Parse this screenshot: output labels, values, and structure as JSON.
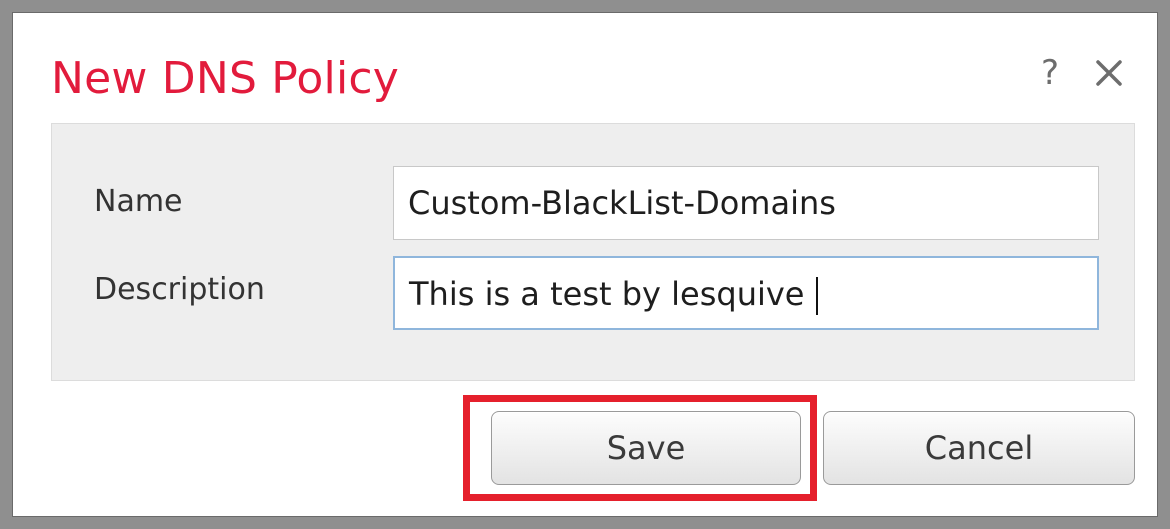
{
  "dialog": {
    "title": "New DNS Policy",
    "help_glyph": "?",
    "icons": [
      "help-icon",
      "close-icon"
    ]
  },
  "form": {
    "name_label": "Name",
    "name_value": "Custom-BlackList-Domains",
    "description_label": "Description",
    "description_value": "This is a test by lesquive"
  },
  "buttons": {
    "save_label": "Save",
    "cancel_label": "Cancel"
  },
  "colors": {
    "title": "#e21b3c",
    "highlight": "#e5202c",
    "focus_border": "#8fb6dc",
    "panel_bg": "#eeeeee"
  }
}
